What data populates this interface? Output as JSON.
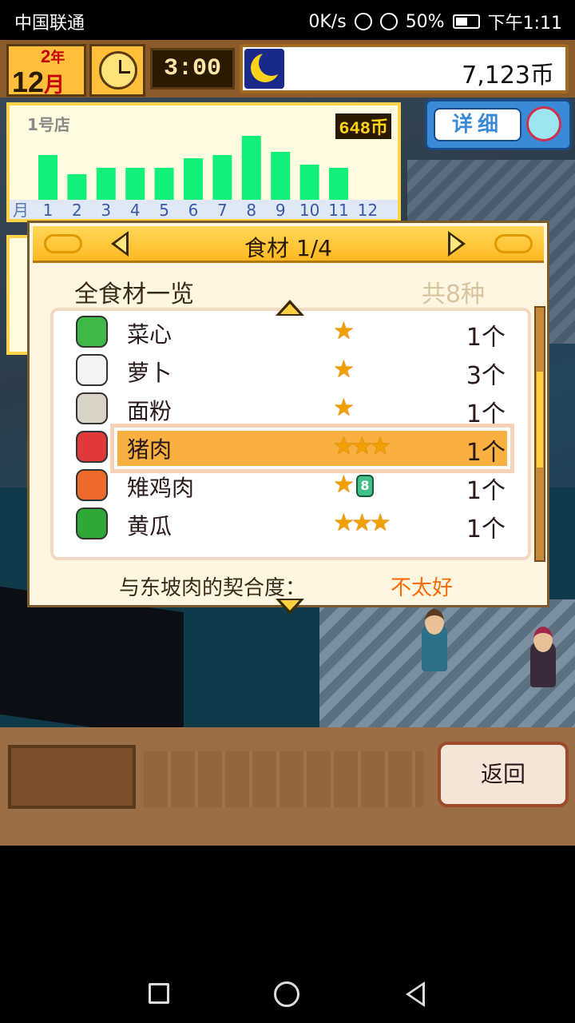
{
  "status_bar": {
    "carrier": "中国联通",
    "net_speed": "0K/s",
    "battery_pct": "50%",
    "time": "下午1:11"
  },
  "hud": {
    "year_num": "2",
    "year_unit": "年",
    "month_num": "12",
    "month_unit": "月",
    "clock_time": "3:00",
    "money": "7,123币"
  },
  "store": {
    "name": "1号店",
    "sales": "648币",
    "month_prefix": "月",
    "chart_data": {
      "type": "bar",
      "categories": [
        "1",
        "2",
        "3",
        "4",
        "5",
        "6",
        "7",
        "8",
        "9",
        "10",
        "11",
        "12"
      ],
      "values": [
        7,
        4,
        5,
        5,
        5,
        6.5,
        7,
        10,
        7.5,
        5.5,
        5,
        0
      ],
      "bar_color": "#13f07a"
    }
  },
  "details_button": {
    "label": "详细"
  },
  "dialog": {
    "title": "食材 1/4",
    "subtitle": "全食材一览",
    "count": "共8种",
    "items": [
      {
        "name": "菜心",
        "stars": "★",
        "qty": "1个",
        "icon": "cabbage-icon",
        "color": "#3fb84a"
      },
      {
        "name": "萝卜",
        "stars": "★",
        "qty": "3个",
        "icon": "radish-icon",
        "color": "#f4f4f4"
      },
      {
        "name": "面粉",
        "stars": "★",
        "qty": "1个",
        "icon": "flour-sack-icon",
        "color": "#d8d4c8"
      },
      {
        "name": "猪肉",
        "stars": "★★★",
        "qty": "1个",
        "icon": "pork-icon",
        "color": "#e03a3a",
        "selected": true
      },
      {
        "name": "雉鸡肉",
        "stars": "★",
        "qty": "1个",
        "icon": "pheasant-meat-icon",
        "color": "#ee6a2a",
        "gem": "8"
      },
      {
        "name": "黄瓜",
        "stars": "★★★",
        "qty": "1个",
        "icon": "cucumber-icon",
        "color": "#2fa83a"
      }
    ],
    "compat_label": "与东坡肉的契合度：",
    "compat_value": "不太好",
    "compat_color": "#ff6a00"
  },
  "back_button": {
    "label": "返回"
  }
}
